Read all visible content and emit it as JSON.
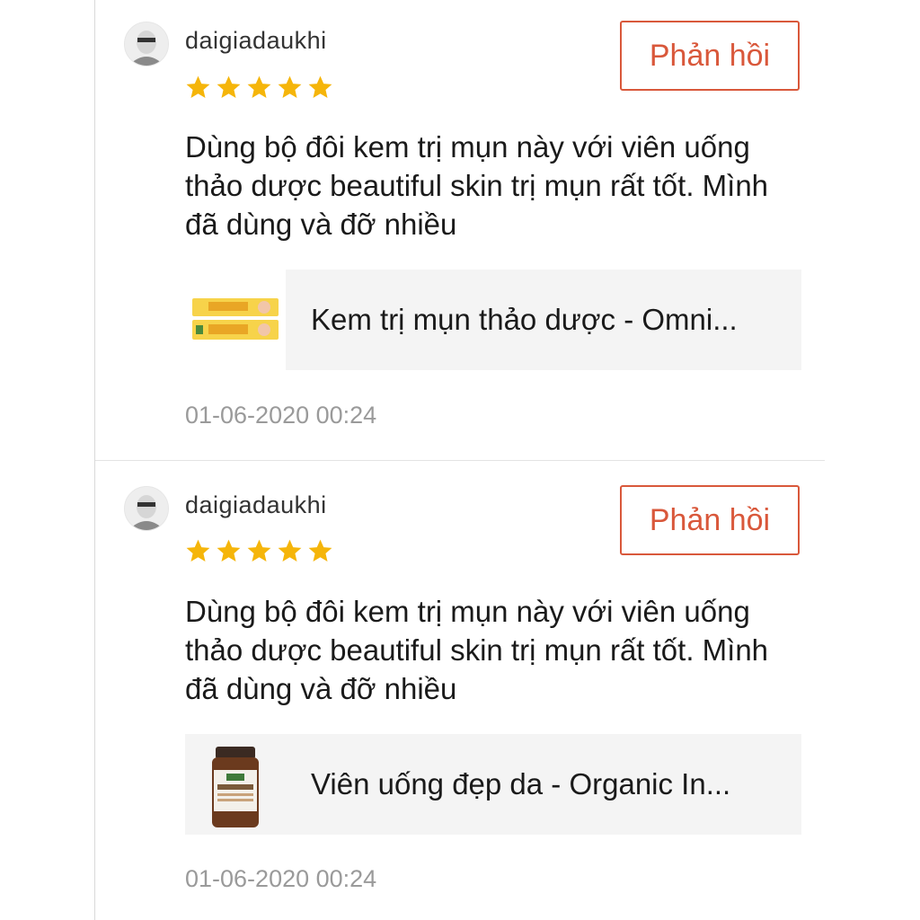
{
  "reviews": [
    {
      "username": "daigiadaukhi",
      "rating": 5,
      "reply_label": "Phản hồi",
      "comment": "Dùng bộ đôi kem trị mụn này với viên uống thảo dược beautiful skin trị mụn rất tốt. Mình đã dùng và đỡ nhiều",
      "product": {
        "name": "Kem trị mụn thảo dược - Omni...",
        "thumb_icon": "cream-tube-image"
      },
      "timestamp": "01-06-2020 00:24"
    },
    {
      "username": "daigiadaukhi",
      "rating": 5,
      "reply_label": "Phản hồi",
      "comment": "Dùng bộ đôi kem trị mụn này với viên uống thảo dược beautiful skin trị mụn rất tốt. Mình đã dùng và đỡ nhiều",
      "product": {
        "name": "Viên uống đẹp da - Organic In...",
        "thumb_icon": "supplement-bottle-image"
      },
      "timestamp": "01-06-2020 00:24"
    }
  ],
  "colors": {
    "accent": "#d9583b",
    "star": "#f5b50a",
    "muted": "#9a9a9a"
  }
}
